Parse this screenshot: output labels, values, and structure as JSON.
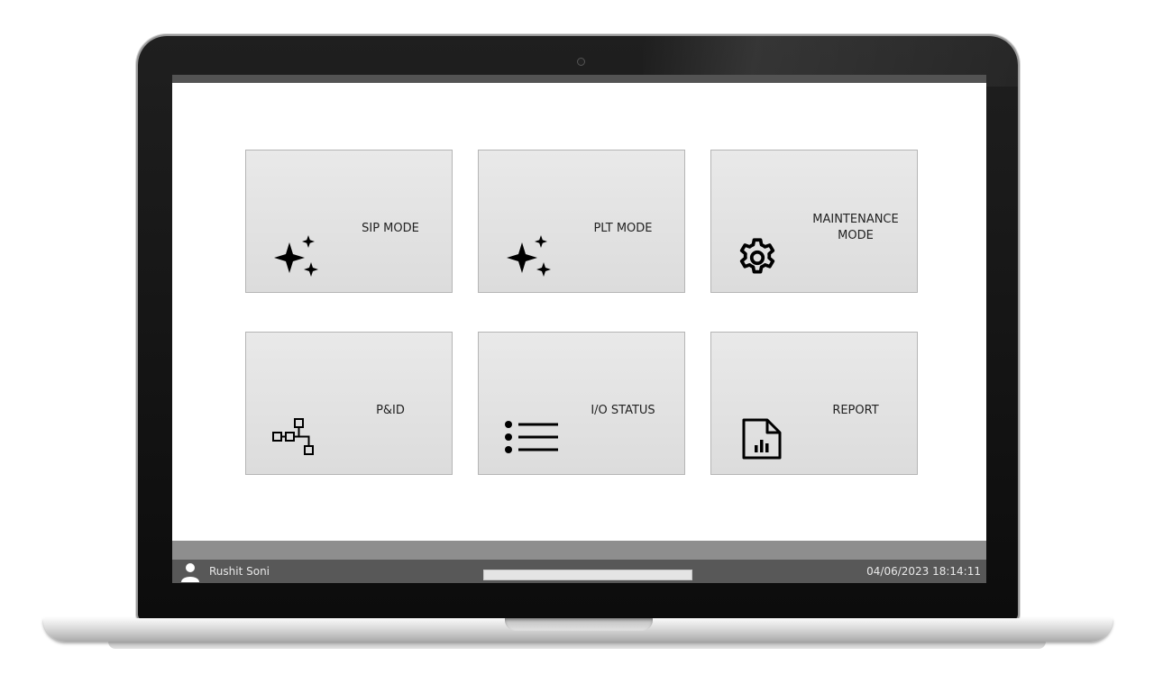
{
  "menu": {
    "tiles": [
      {
        "label": "SIP MODE",
        "icon": "sparkle-icon"
      },
      {
        "label": "PLT MODE",
        "icon": "sparkle-icon"
      },
      {
        "label": "MAINTENANCE MODE",
        "icon": "gear-icon"
      },
      {
        "label": "P&ID",
        "icon": "flow-diagram-icon"
      },
      {
        "label": "I/O STATUS",
        "icon": "list-icon"
      },
      {
        "label": "REPORT",
        "icon": "report-chart-icon"
      }
    ]
  },
  "status_bar": {
    "user_name": "Rushit Soni",
    "datetime": "04/06/2023 18:14:11",
    "progress_percent": 100
  },
  "colors": {
    "tile_bg": "#e2e2e2",
    "status_bar": "#585858",
    "header_bar": "#535353"
  }
}
